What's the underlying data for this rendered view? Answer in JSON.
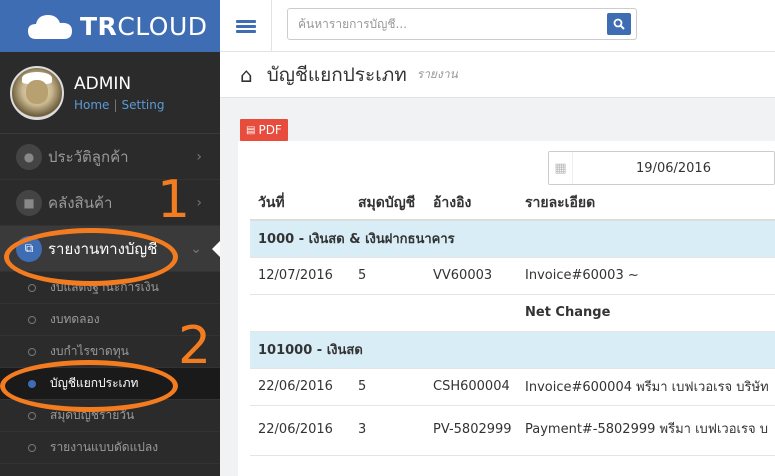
{
  "brand": {
    "name_bold": "TR",
    "name_rest": "CLOUD"
  },
  "user": {
    "name": "ADMIN",
    "home_link": "Home",
    "separator": "|",
    "setting_link": "Setting"
  },
  "sidebar": {
    "items": [
      {
        "label": "ประวัติลูกค้า",
        "icon": "users-icon"
      },
      {
        "label": "คลังสินค้า",
        "icon": "truck-icon"
      },
      {
        "label": "รายงานทางบัญชี",
        "icon": "copy-icon"
      }
    ],
    "subitems": [
      {
        "label": "งบแสดงฐานะการเงิน"
      },
      {
        "label": "งบทดลอง"
      },
      {
        "label": "งบกำไรขาดทุน"
      },
      {
        "label": "บัญชีแยกประเภท"
      },
      {
        "label": "สมุดบัญชีรายวัน"
      },
      {
        "label": "รายงานแบบดัดแปลง"
      }
    ]
  },
  "topbar": {
    "search_placeholder": "ค้นหารายการบัญชี..."
  },
  "page": {
    "title": "บัญชีแยกประเภท",
    "subtitle": "รายงาน"
  },
  "toolbar": {
    "pdf_label": "PDF"
  },
  "filter": {
    "date": "19/06/2016"
  },
  "table": {
    "headers": {
      "date": "วันที่",
      "journal": "สมุดบัญชี",
      "ref": "อ้างอิง",
      "detail": "รายละเอียด"
    },
    "group1": {
      "title": "1000 - เงินสด & เงินฝากธนาคาร"
    },
    "row1": {
      "date": "12/07/2016",
      "journal": "5",
      "ref": "VV60003",
      "detail": "Invoice#60003 ~"
    },
    "net": {
      "label": "Net Change"
    },
    "group2": {
      "title": "101000 - เงินสด"
    },
    "row2": {
      "date": "22/06/2016",
      "journal": "5",
      "ref": "CSH600004",
      "detail": "Invoice#600004 พรีมา เบฟเวอเรจ บริษัท"
    },
    "row3": {
      "date": "22/06/2016",
      "journal": "3",
      "ref": "PV-5802999",
      "detail": "Payment#-5802999 พรีมา เบฟเวอเรจ บ"
    }
  },
  "annotations": {
    "label1": "1",
    "label2": "2",
    "color": "#f47c20"
  },
  "colors": {
    "brand": "#3e6db3",
    "sidebar_bg": "#2b2b2b",
    "pdf": "#e84c3d",
    "group_row": "#d9edf7"
  }
}
